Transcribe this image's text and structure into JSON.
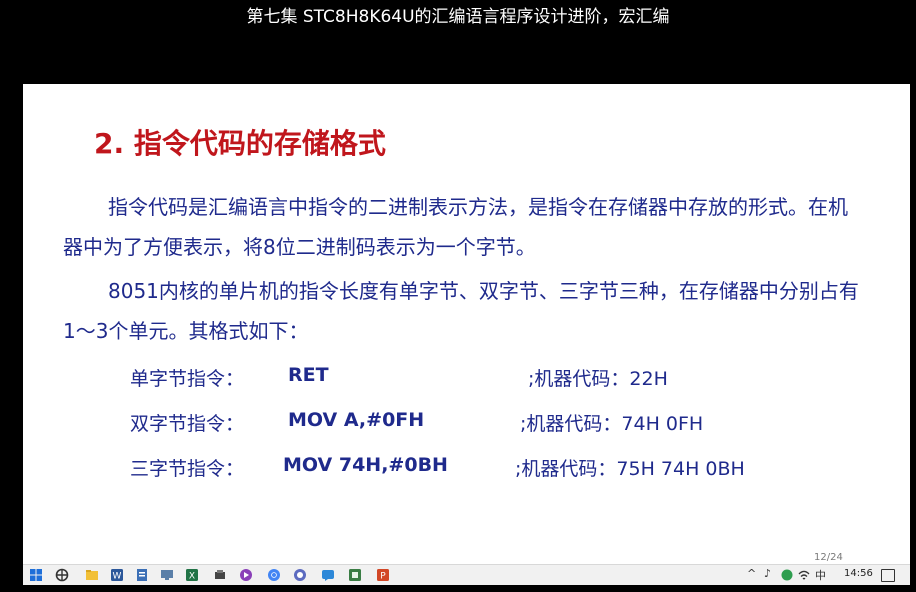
{
  "video_title": "第七集 STC8H8K64U的汇编语言程序设计进阶，宏汇编",
  "slide": {
    "heading": "2. 指令代码的存储格式",
    "paragraph1": "指令代码是汇编语言中指令的二进制表示方法，是指令在存储器中存放的形式。在机器中为了方便表示，将8位二进制码表示为一个字节。",
    "paragraph2": "8051内核的单片机的指令长度有单字节、双字节、三字节三种，在存储器中分别占有1～3个单元。其格式如下：",
    "rows": [
      {
        "label": "单字节指令：",
        "code": "RET",
        "machine": ";机器代码：22H"
      },
      {
        "label": "双字节指令：",
        "code": "MOV  A,#0FH",
        "machine": ";机器代码：74H 0FH"
      },
      {
        "label": "三字节指令：",
        "code": "MOV  74H,#0BH",
        "machine": ";机器代码：75H 74H 0BH"
      }
    ],
    "page_number": "12/24"
  },
  "taskbar": {
    "time": "14:56",
    "tray_symbols": [
      "^",
      "♪",
      "中"
    ],
    "colors": {
      "word": "#2b579a",
      "excel": "#217346",
      "ppt": "#d24726",
      "chrome": "#4285f4"
    }
  }
}
